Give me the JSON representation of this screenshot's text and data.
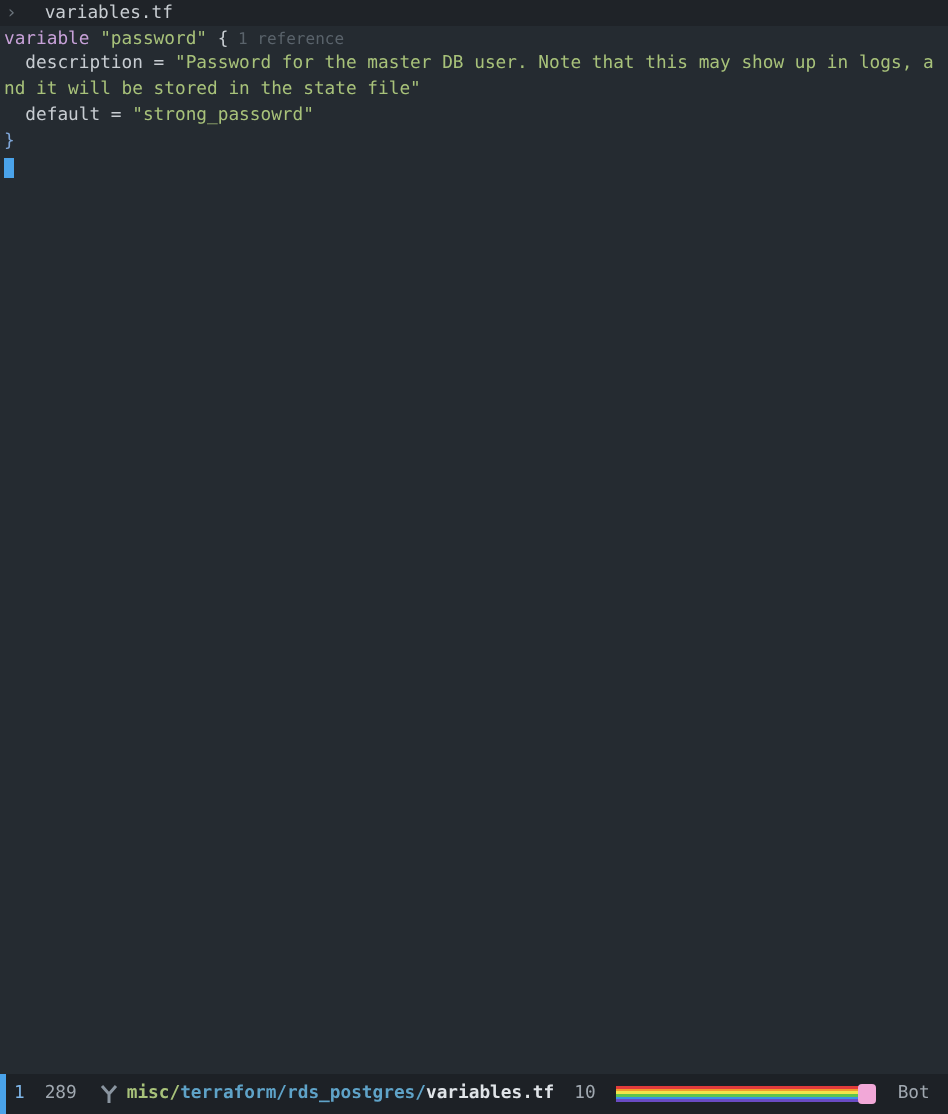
{
  "breadcrumb": {
    "chevron": "›",
    "file": "variables.tf"
  },
  "lines": [
    {
      "segments": [
        {
          "kind": "keyword",
          "text": "variable "
        },
        {
          "kind": "string",
          "text": "\"password\""
        },
        {
          "kind": "plain",
          "text": " {"
        },
        {
          "kind": "hint",
          "text": " 1 reference"
        }
      ]
    },
    {
      "segments": [
        {
          "kind": "plain",
          "text": "  description = "
        },
        {
          "kind": "string",
          "text": "\"Password for the master DB user. Note that this may show up in logs, a"
        }
      ]
    },
    {
      "segments": [
        {
          "kind": "string",
          "text": "nd it will be stored in the state file\""
        }
      ]
    },
    {
      "segments": [
        {
          "kind": "plain",
          "text": "  default = "
        },
        {
          "kind": "string",
          "text": "\"strong_passowrd\""
        }
      ]
    },
    {
      "segments": [
        {
          "kind": "brace",
          "text": "}"
        }
      ]
    }
  ],
  "status_bar": {
    "mode": "1",
    "count": "289",
    "path": [
      {
        "kind": "dir",
        "text": "misc/"
      },
      {
        "kind": "dir2",
        "text": "terraform/"
      },
      {
        "kind": "dir2",
        "text": "rds_postgres/"
      },
      {
        "kind": "file",
        "text": "variables.tf"
      }
    ],
    "line": "10",
    "scroll": {
      "level": 0.95
    },
    "position": "Bot"
  }
}
